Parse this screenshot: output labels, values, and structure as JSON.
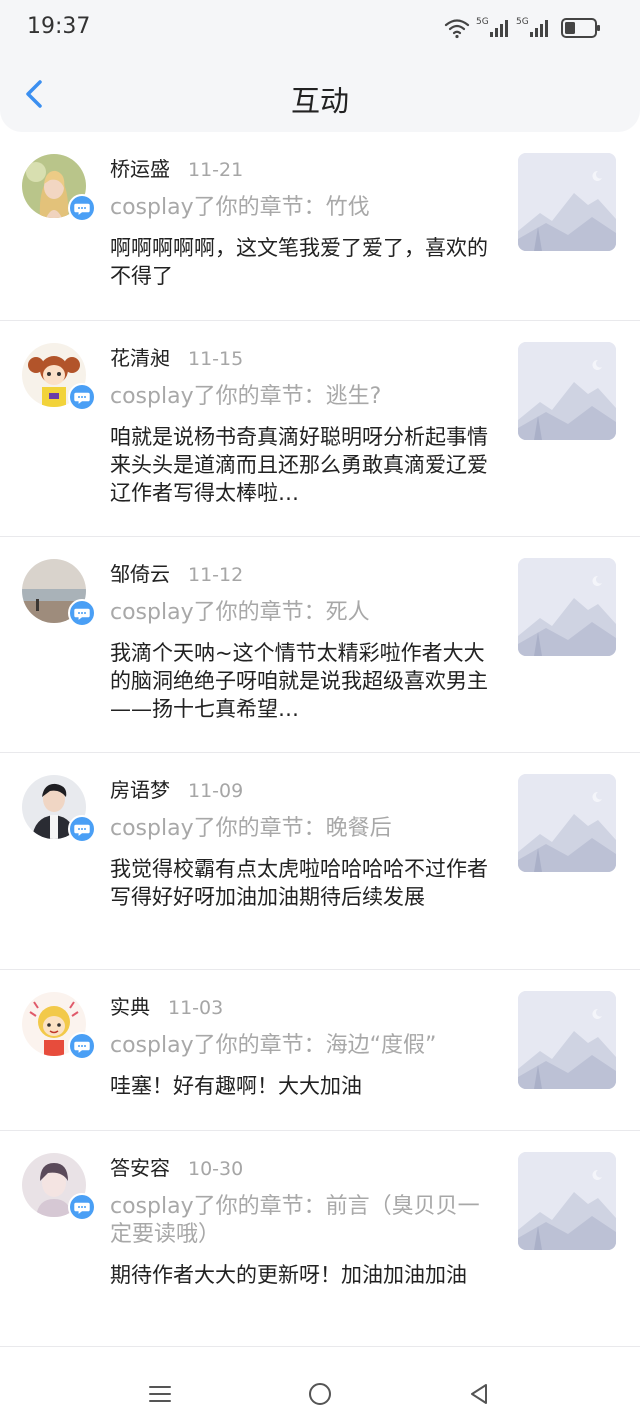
{
  "status_bar": {
    "time": "19:37",
    "network1": "5G",
    "network2": "5G"
  },
  "header": {
    "title": "互动"
  },
  "colors": {
    "accent": "#4a9ff5",
    "secondary_text": "#a8a8a8",
    "header_bg": "#f5f6f8"
  },
  "items": [
    {
      "name": "桥运盛",
      "date": "11-21",
      "chapter": "cosplay了你的章节：竹伐",
      "comment": "啊啊啊啊啊，这文笔我爱了爱了，喜欢的不得了",
      "avatar": "blonde-girl-avatar"
    },
    {
      "name": "花清昶",
      "date": "11-15",
      "chapter": "cosplay了你的章节：逃生?",
      "comment": "咱就是说杨书奇真滴好聪明呀分析起事情来头头是道滴而且还那么勇敢真滴爱辽爱辽作者写得太棒啦…",
      "avatar": "cartoon-girl-avatar"
    },
    {
      "name": "邹倚云",
      "date": "11-12",
      "chapter": "cosplay了你的章节：死人",
      "comment": "我滴个天呐~这个情节太精彩啦作者大大的脑洞绝绝子呀咱就是说我超级喜欢男主——扬十七真希望…",
      "avatar": "beach-sunset-avatar"
    },
    {
      "name": "房语梦",
      "date": "11-09",
      "chapter": "cosplay了你的章节：晚餐后",
      "comment": "我觉得校霸有点太虎啦哈哈哈哈不过作者写得好好呀加油加油期待后续发展",
      "avatar": "young-man-avatar"
    },
    {
      "name": "实典",
      "date": "11-03",
      "chapter": "cosplay了你的章节：海边“度假”",
      "comment": "哇塞！好有趣啊！大大加油",
      "avatar": "cartoon-kid-avatar"
    },
    {
      "name": "答安容",
      "date": "10-30",
      "chapter": "cosplay了你的章节：前言（臭贝贝一定要读哦）",
      "comment": "期待作者大大的更新呀！加油加油加油",
      "avatar": "pale-boy-avatar"
    }
  ],
  "nav": {
    "menu": "menu-icon",
    "home": "home-circle-icon",
    "back": "back-triangle-icon"
  }
}
